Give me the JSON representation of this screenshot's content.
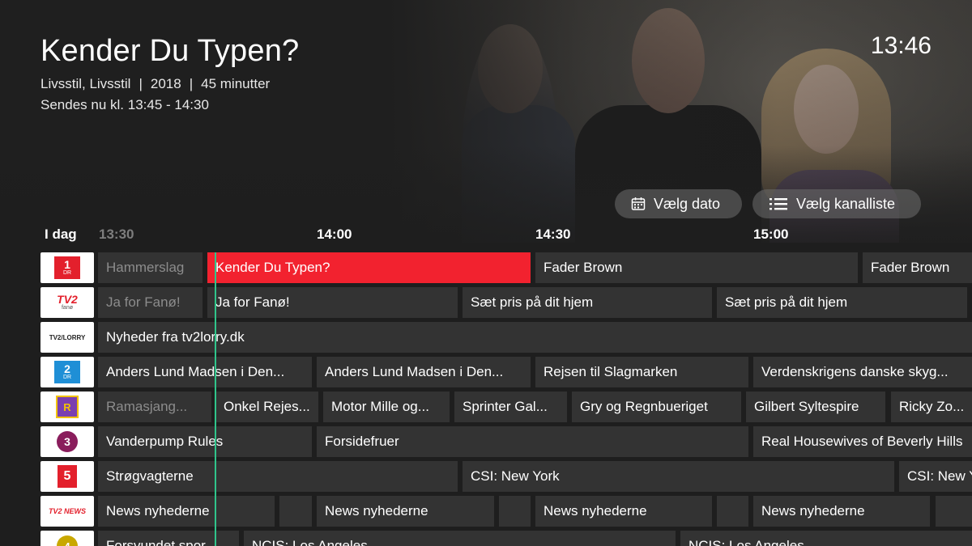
{
  "program": {
    "title": "Kender Du Typen?",
    "genre": "Livsstil, Livsstil",
    "year": "2018",
    "duration": "45 minutter",
    "airing": "Sendes nu kl. 13:45 - 14:30"
  },
  "clock": "13:46",
  "buttons": {
    "choose_date": "Vælg dato",
    "choose_channel_list": "Vælg kanalliste"
  },
  "timeline": {
    "day": "I dag",
    "ticks": [
      "13:30",
      "14:00",
      "14:30",
      "15:00"
    ]
  },
  "channels": [
    {
      "logo": "DR1",
      "logo_text": "1",
      "logo_sub": "DR",
      "logo_color": "#e3202c",
      "programs": [
        "Hammerslag",
        "Kender Du Typen?",
        "Fader Brown",
        "Fader Brown"
      ]
    },
    {
      "logo": "TV2 Fanø",
      "logo_text": "TV2",
      "logo_sub": "fanø",
      "logo_color": "#e3202c",
      "programs": [
        "Ja for Fanø!",
        "Ja for Fanø!",
        "Sæt pris på dit hjem",
        "Sæt pris på dit hjem"
      ]
    },
    {
      "logo": "TV2 Lorry",
      "logo_text": "TV2/LORRY",
      "logo_color": "#222222",
      "programs": [
        "Nyheder fra tv2lorry.dk"
      ]
    },
    {
      "logo": "DR2",
      "logo_text": "2",
      "logo_sub": "DR",
      "logo_color": "#1f8fd6",
      "programs": [
        "Anders Lund Madsen i Den...",
        "Anders Lund Madsen i Den...",
        "Rejsen til Slagmarken",
        "Verdenskrigens danske skyg..."
      ]
    },
    {
      "logo": "DR Ramasjang",
      "logo_text": "R",
      "logo_color": "#7a3fb0",
      "programs": [
        "Ramasjang...",
        "Onkel Rejes...",
        "Motor Mille og...",
        "Sprinter Gal...",
        "Gry og Regnbueriget",
        "Gilbert Syltespire",
        "Ricky Zo..."
      ]
    },
    {
      "logo": "Kanal 3",
      "logo_text": "3",
      "logo_color": "#8a1d5c",
      "programs": [
        "Vanderpump Rules",
        "Forsidefruer",
        "Real Housewives of Beverly Hills"
      ]
    },
    {
      "logo": "Kanal 5",
      "logo_text": "5",
      "logo_color": "#e3202c",
      "programs": [
        "Strøgvagterne",
        "CSI: New York",
        "CSI: New York"
      ]
    },
    {
      "logo": "TV2 News",
      "logo_text": "TV2 NEWS",
      "logo_color": "#e3202c",
      "programs": [
        "News nyhederne",
        "",
        "News nyhederne",
        "",
        "News nyhederne",
        "",
        "News nyhederne",
        ""
      ]
    },
    {
      "logo": "Kanal 4",
      "logo_text": "4",
      "logo_color": "#c9a800",
      "programs": [
        "Forsvundet spor",
        "NCIS: Los Angeles",
        "NCIS: Los Angeles"
      ]
    }
  ],
  "colors": {
    "active": "#f2222f",
    "now_line": "#2fc58b",
    "cell_bg": "#333333"
  }
}
